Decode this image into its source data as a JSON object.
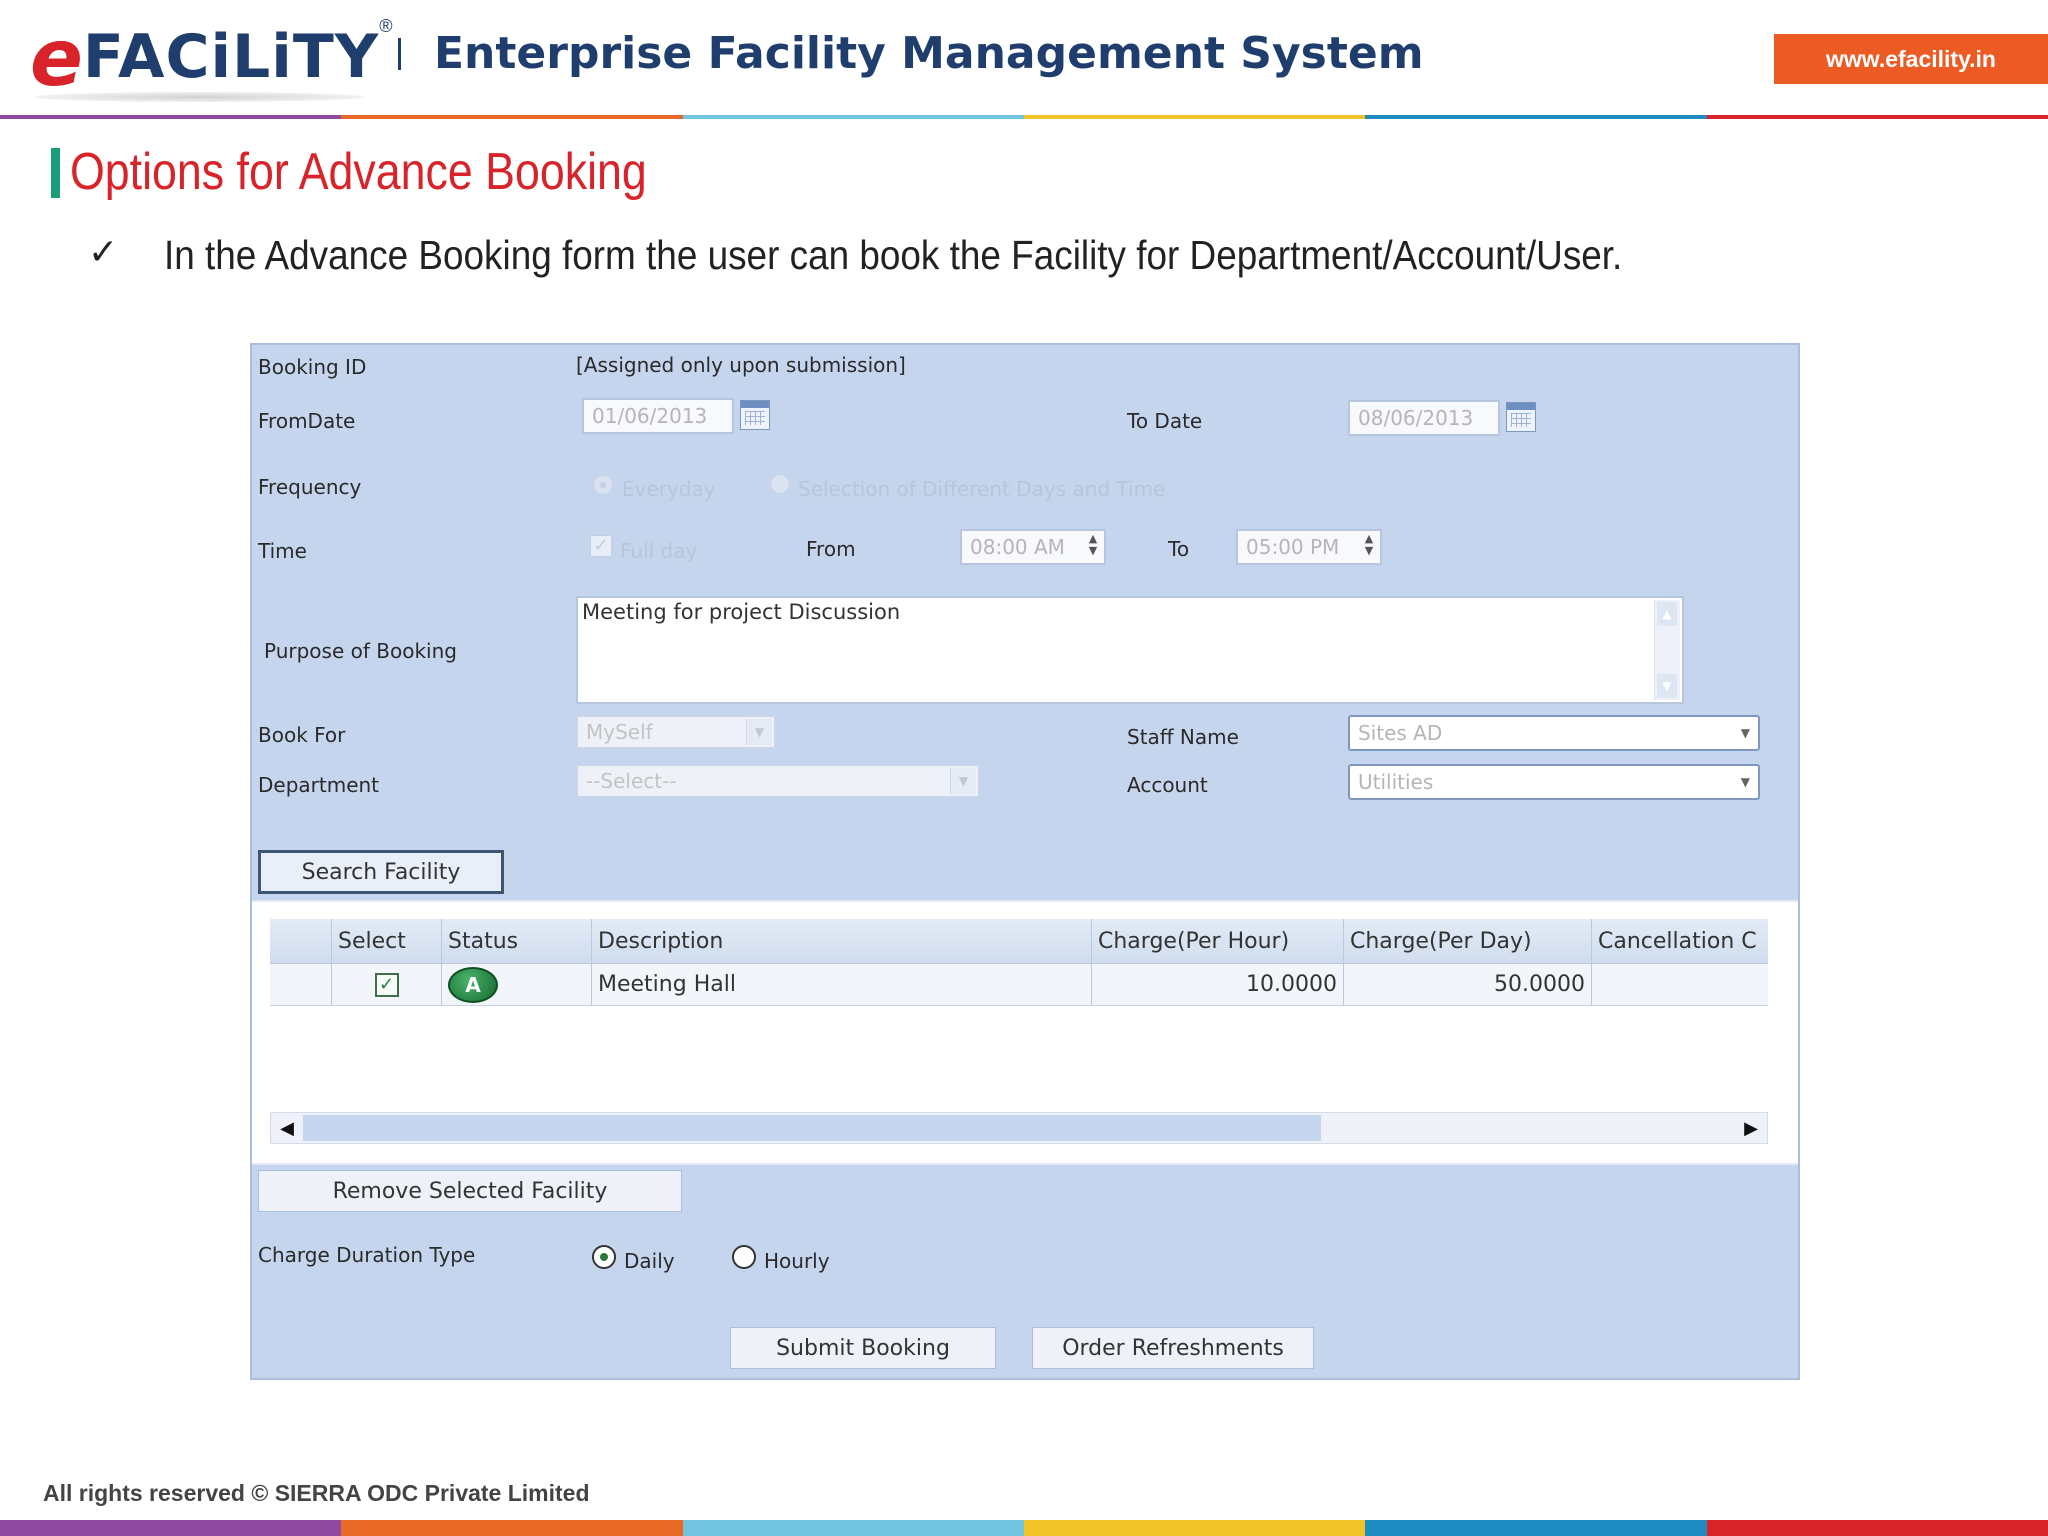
{
  "header": {
    "logo_e": "e",
    "logo_rest": "FACiLiTY",
    "logo_reg": "®",
    "title": "Enterprise Facility Management System",
    "url": "www.efacility.in"
  },
  "colors": {
    "stripe": [
      "#8e4a9e",
      "#e96a26",
      "#72c4df",
      "#f3c32a",
      "#1f8cc1",
      "#d8232a"
    ],
    "accent_red": "#d8232a",
    "accent_green": "#1a9e7a",
    "brand_blue": "#1f3e6e",
    "url_orange": "#ec5b24"
  },
  "section": {
    "title": "Options for Advance Booking",
    "bullet_icon": "checkmark-icon",
    "bullet": "In the Advance Booking form the user can book the Facility for Department/Account/User."
  },
  "form": {
    "booking_id": {
      "label": "Booking ID",
      "value": "[Assigned only upon submission]"
    },
    "from_date": {
      "label": "FromDate",
      "value": "01/06/2013"
    },
    "to_date": {
      "label": "To Date",
      "value": "08/06/2013"
    },
    "frequency": {
      "label": "Frequency",
      "opt1": "Everyday",
      "opt2": "Selection of Different Days and Time"
    },
    "time": {
      "label": "Time",
      "full_day": "Full day",
      "from_label": "From",
      "from_value": "08:00 AM",
      "to_label": "To",
      "to_value": "05:00 PM"
    },
    "purpose": {
      "label": "Purpose of Booking",
      "value": "Meeting for project Discussion"
    },
    "book_for": {
      "label": "Book For",
      "value": "MySelf"
    },
    "staff_name": {
      "label": "Staff Name",
      "value": "Sites AD"
    },
    "department": {
      "label": "Department",
      "value": "--Select--"
    },
    "account": {
      "label": "Account",
      "value": "Utilities"
    },
    "search_button": "Search Facility",
    "grid": {
      "columns": [
        "Select",
        "Status",
        "Description",
        "Charge(Per Hour)",
        "Charge(Per Day)",
        "Cancellation C"
      ],
      "rows": [
        {
          "status": "A",
          "description": "Meeting Hall",
          "charge_hour": "10.0000",
          "charge_day": "50.0000",
          "cancellation": ""
        }
      ]
    },
    "remove_button": "Remove Selected Facility",
    "charge_duration": {
      "label": "Charge Duration Type",
      "daily": "Daily",
      "hourly": "Hourly",
      "selected": "Daily"
    },
    "submit_button": "Submit Booking",
    "refreshments_button": "Order Refreshments"
  },
  "footer": {
    "copyright": "All rights reserved © SIERRA ODC Private Limited"
  }
}
